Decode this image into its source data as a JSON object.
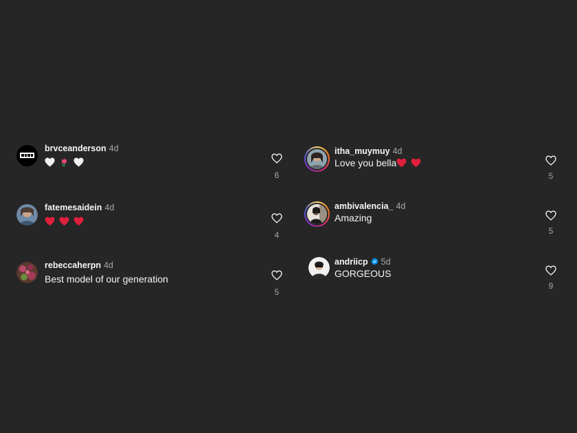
{
  "comments_left": [
    {
      "username": "brvceanderson",
      "time": "4d",
      "text": "",
      "emoji_sequence": [
        "white-heart",
        "tulip",
        "white-heart"
      ],
      "likes": "6"
    },
    {
      "username": "fatemesaidein",
      "time": "4d",
      "text": "",
      "emoji_sequence": [
        "red-heart",
        "red-heart",
        "red-heart"
      ],
      "likes": "4"
    },
    {
      "username": "rebeccaherpn",
      "time": "4d",
      "text": "Best model of our generation",
      "likes": "5"
    }
  ],
  "comments_right": [
    {
      "username": "itha_muymuy",
      "time": "4d",
      "text": "Love you bella",
      "emoji_sequence": [
        "red-heart",
        "red-heart"
      ],
      "likes": "5"
    },
    {
      "username": "ambivalencia_",
      "time": "4d",
      "text": "Amazing",
      "likes": "5"
    },
    {
      "username": "andriicp",
      "time": "5d",
      "verified": true,
      "text": "GORGEOUS",
      "likes": "9"
    }
  ],
  "colors": {
    "background": "#262626",
    "text_primary": "#f5f5f5",
    "text_secondary": "#a8a8a8",
    "verified_blue": "#0095f6",
    "red_heart": "#e0245e"
  },
  "icons": {
    "like": "heart-outline-icon",
    "verified": "verified-badge-icon"
  }
}
